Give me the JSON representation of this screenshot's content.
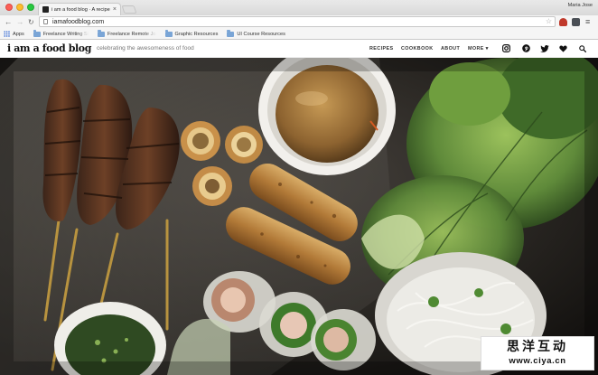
{
  "browser": {
    "tab": {
      "title": "i am a food blog · A recipe",
      "close": "×"
    },
    "profile_name": "Maria Jose",
    "nav": {
      "back": "←",
      "forward": "→",
      "reload": "↻"
    },
    "url": "iamafoodblog.com",
    "star": "☆",
    "menu_glyph": "≡",
    "bookmarks": [
      {
        "label": "Apps"
      },
      {
        "label": "Freelance Writing Si"
      },
      {
        "label": "Freelance Remote Jo"
      },
      {
        "label": "Graphic Resources"
      },
      {
        "label": "UI Course Resources"
      }
    ]
  },
  "site": {
    "logo": "i am a food blog",
    "tagline": "celebrating the awesomeness of food",
    "menu": {
      "recipes": "RECIPES",
      "cookbook": "COOKBOOK",
      "about": "ABOUT",
      "more": "MORE ▾"
    },
    "social_icons": [
      "instagram-icon",
      "pinterest-icon",
      "twitter-icon",
      "heart-icon",
      "search-icon"
    ]
  },
  "watermark": {
    "chinese": "思洋互动",
    "url": "www.ciya.cn"
  },
  "colors": {
    "accent_red": "#c0392b",
    "photo_background": "#1c1a17",
    "sauce": "#a87a3a",
    "lettuce": "#5f8a3a"
  }
}
